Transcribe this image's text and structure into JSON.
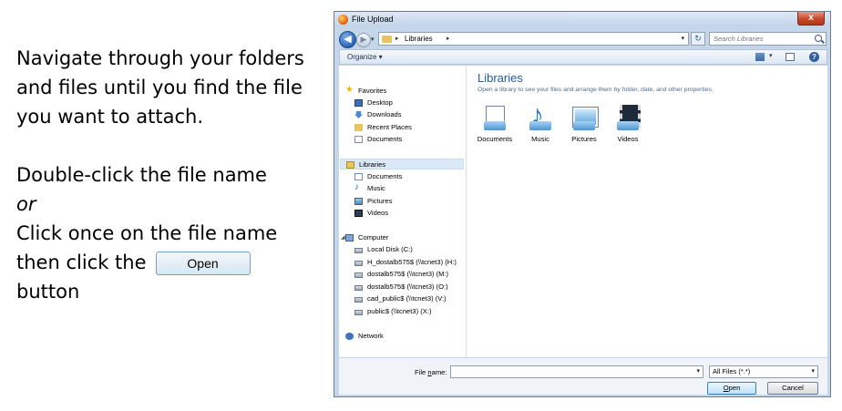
{
  "instructions": {
    "line1": "Navigate through your folders",
    "line2": "and files until you find the file",
    "line3": "you want to attach.",
    "line4": "Double-click the file name",
    "line5": "or",
    "line6": "Click once on the file name",
    "line7": "then click the",
    "sample_button": "Open",
    "line8": "button"
  },
  "dialog": {
    "title": "File Upload",
    "close_glyph": "x",
    "address": {
      "location": "Libraries",
      "arrow": "▸",
      "dropdown": "▾"
    },
    "search": {
      "placeholder": "Search Libraries"
    },
    "toolbar": {
      "organize": "Organize ▾"
    },
    "nav": {
      "favorites": "Favorites",
      "favorite_items": [
        "Desktop",
        "Downloads",
        "Recent Places",
        "Documents"
      ],
      "libraries": "Libraries",
      "library_items": [
        "Documents",
        "Music",
        "Pictures",
        "Videos"
      ],
      "computer": "Computer",
      "computer_items": [
        "Local Disk (C:)",
        "H_dostalb575$ (\\\\tcnet3) (H:)",
        "dostalb575$ (\\\\tcnet3) (M:)",
        "dostalb575$ (\\\\tcnet3) (O:)",
        "cad_public$ (\\\\tcnet3) (V:)",
        "public$ (\\\\tcnet3) (X:)"
      ],
      "network": "Network"
    },
    "content": {
      "title": "Libraries",
      "subtitle": "Open a library to see your files and arrange them by folder, date, and other properties.",
      "tiles": [
        "Documents",
        "Music",
        "Pictures",
        "Videos"
      ]
    },
    "footer": {
      "file_name_label_pre": "File ",
      "file_name_label_u": "n",
      "file_name_label_post": "ame:",
      "file_name_value": "",
      "filter_value": "All Files (*.*)",
      "open_button_u": "O",
      "open_button_rest": "pen",
      "cancel_button": "Cancel"
    }
  }
}
